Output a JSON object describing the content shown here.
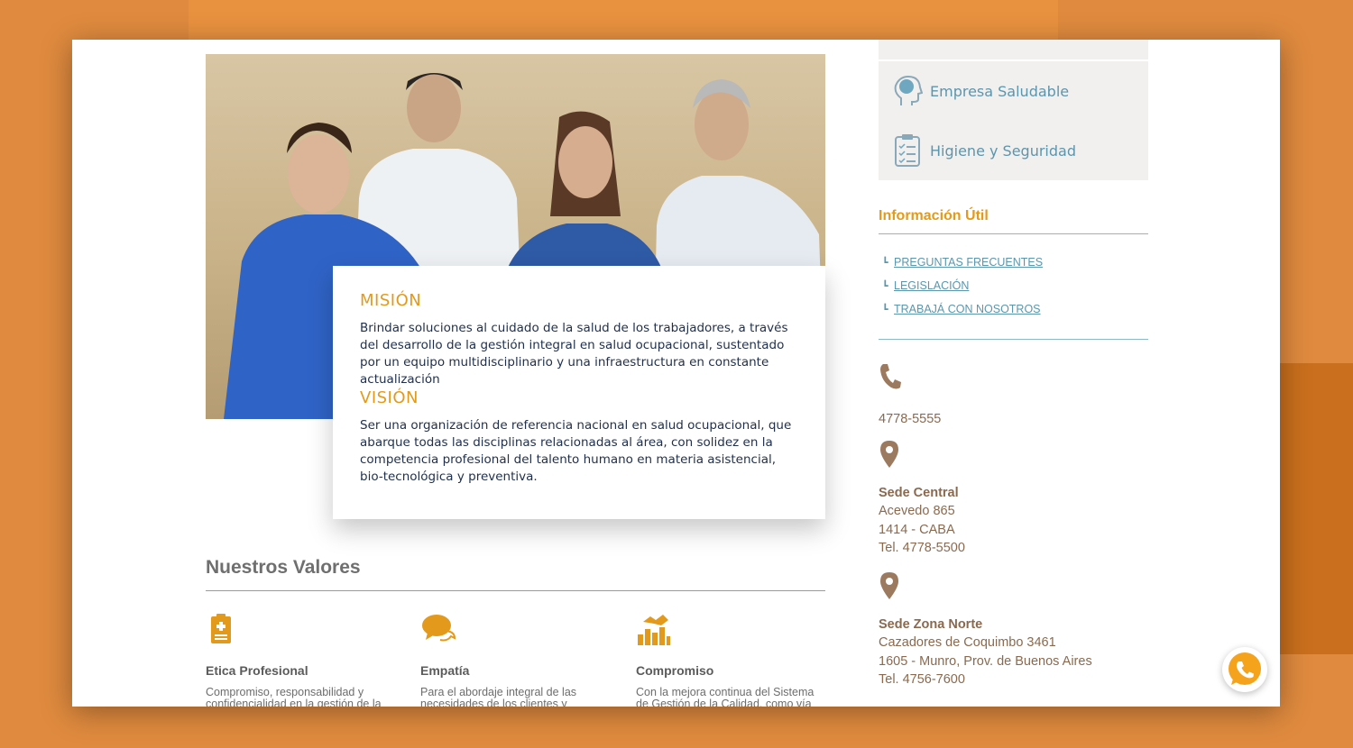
{
  "hero": {
    "mision_title": "MISIÓN",
    "mision_text": "Brindar soluciones al cuidado de la salud de los trabajadores, a través del desarrollo de la gestión integral en salud ocupacional, sustentado por un equipo multidisciplinario y una infraestructura en constante actualización",
    "vision_title": "VISIÓN",
    "vision_text": "Ser una organización de referencia nacional en salud ocupacional, que abarque todas las disciplinas relacionadas al área, con solidez en la competencia profesional del talento humano en materia asistencial, bio-tecnológica y preventiva."
  },
  "values": {
    "title": "Nuestros Valores",
    "items": [
      {
        "name": "Etica Profesional",
        "desc": "Compromiso, responsabilidad y confidencialidad en la gestión de la",
        "icon": "clipboard-plus-icon"
      },
      {
        "name": "Empatía",
        "desc": "Para el abordaje integral de las necesidades de los clientes y",
        "icon": "speech-bubbles-icon"
      },
      {
        "name": "Compromiso",
        "desc": "Con la mejora continua del Sistema de Gestión de la Calidad, como vía",
        "icon": "handshake-chart-icon"
      }
    ]
  },
  "sidebar": {
    "services": [
      {
        "label": "Empresa Saludable",
        "icon": "head-brain-icon"
      },
      {
        "label": "Higiene y Seguridad",
        "icon": "checklist-clipboard-icon"
      }
    ],
    "info_title": "Información Útil",
    "links": [
      {
        "label": "PREGUNTAS FRECUENTES"
      },
      {
        "label": "LEGISLACIÓN"
      },
      {
        "label": "TRABAJÁ CON NOSOTROS"
      }
    ],
    "phone": "4778-5555",
    "sede_central": {
      "name": "Sede Central",
      "line1": "Acevedo 865",
      "line2": "1414 - CABA",
      "tel": "Tel. 4778-5500"
    },
    "sede_norte": {
      "name": "Sede Zona Norte",
      "line1": "Cazadores de Coquimbo 3461",
      "line2": "1605 - Munro, Prov. de Buenos Aires",
      "tel": "Tel. 4756-7600"
    }
  },
  "colors": {
    "accent": "#e39a1c",
    "link": "#5b96ad",
    "contact": "#8a6a4f",
    "background": "#df8a3e"
  }
}
